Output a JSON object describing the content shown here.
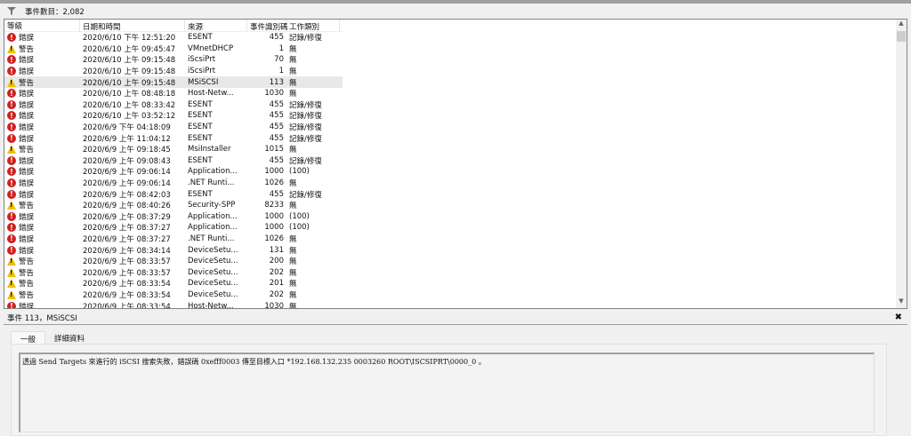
{
  "toolbar": {
    "filter_icon": "filter-icon",
    "count_label": "事件數目：2,082"
  },
  "columns": [
    "等級",
    "日期和時間",
    "來源",
    "事件識別碼",
    "工作類別"
  ],
  "rows": [
    {
      "level": "錯誤",
      "type": "error",
      "date": "2020/6/10 下午 12:51:20",
      "source": "ESENT",
      "id": "455",
      "category": "記錄/修復"
    },
    {
      "level": "警告",
      "type": "warning",
      "date": "2020/6/10 上午 09:45:47",
      "source": "VMnetDHCP",
      "id": "1",
      "category": "無"
    },
    {
      "level": "錯誤",
      "type": "error",
      "date": "2020/6/10 上午 09:15:48",
      "source": "iScsiPrt",
      "id": "70",
      "category": "無"
    },
    {
      "level": "錯誤",
      "type": "error",
      "date": "2020/6/10 上午 09:15:48",
      "source": "iScsiPrt",
      "id": "1",
      "category": "無"
    },
    {
      "level": "警告",
      "type": "warning",
      "date": "2020/6/10 上午 09:15:48",
      "source": "MSiSCSI",
      "id": "113",
      "category": "無",
      "selected": true
    },
    {
      "level": "錯誤",
      "type": "error",
      "date": "2020/6/10 上午 08:48:18",
      "source": "Host-Netw...",
      "id": "1030",
      "category": "無"
    },
    {
      "level": "錯誤",
      "type": "error",
      "date": "2020/6/10 上午 08:33:42",
      "source": "ESENT",
      "id": "455",
      "category": "記錄/修復"
    },
    {
      "level": "錯誤",
      "type": "error",
      "date": "2020/6/10 上午 03:52:12",
      "source": "ESENT",
      "id": "455",
      "category": "記錄/修復"
    },
    {
      "level": "錯誤",
      "type": "error",
      "date": "2020/6/9 下午 04:18:09",
      "source": "ESENT",
      "id": "455",
      "category": "記錄/修復"
    },
    {
      "level": "錯誤",
      "type": "error",
      "date": "2020/6/9 上午 11:04:12",
      "source": "ESENT",
      "id": "455",
      "category": "記錄/修復"
    },
    {
      "level": "警告",
      "type": "warning",
      "date": "2020/6/9 上午 09:18:45",
      "source": "MsiInstaller",
      "id": "1015",
      "category": "無"
    },
    {
      "level": "錯誤",
      "type": "error",
      "date": "2020/6/9 上午 09:08:43",
      "source": "ESENT",
      "id": "455",
      "category": "記錄/修復"
    },
    {
      "level": "錯誤",
      "type": "error",
      "date": "2020/6/9 上午 09:06:14",
      "source": "Application...",
      "id": "1000",
      "category": "(100)"
    },
    {
      "level": "錯誤",
      "type": "error",
      "date": "2020/6/9 上午 09:06:14",
      "source": ".NET Runti...",
      "id": "1026",
      "category": "無"
    },
    {
      "level": "錯誤",
      "type": "error",
      "date": "2020/6/9 上午 08:42:03",
      "source": "ESENT",
      "id": "455",
      "category": "記錄/修復"
    },
    {
      "level": "警告",
      "type": "warning",
      "date": "2020/6/9 上午 08:40:26",
      "source": "Security-SPP",
      "id": "8233",
      "category": "無"
    },
    {
      "level": "錯誤",
      "type": "error",
      "date": "2020/6/9 上午 08:37:29",
      "source": "Application...",
      "id": "1000",
      "category": "(100)"
    },
    {
      "level": "錯誤",
      "type": "error",
      "date": "2020/6/9 上午 08:37:27",
      "source": "Application...",
      "id": "1000",
      "category": "(100)"
    },
    {
      "level": "錯誤",
      "type": "error",
      "date": "2020/6/9 上午 08:37:27",
      "source": ".NET Runti...",
      "id": "1026",
      "category": "無"
    },
    {
      "level": "錯誤",
      "type": "error",
      "date": "2020/6/9 上午 08:34:14",
      "source": "DeviceSetu...",
      "id": "131",
      "category": "無"
    },
    {
      "level": "警告",
      "type": "warning",
      "date": "2020/6/9 上午 08:33:57",
      "source": "DeviceSetu...",
      "id": "200",
      "category": "無"
    },
    {
      "level": "警告",
      "type": "warning",
      "date": "2020/6/9 上午 08:33:57",
      "source": "DeviceSetu...",
      "id": "202",
      "category": "無"
    },
    {
      "level": "警告",
      "type": "warning",
      "date": "2020/6/9 上午 08:33:54",
      "source": "DeviceSetu...",
      "id": "201",
      "category": "無"
    },
    {
      "level": "警告",
      "type": "warning",
      "date": "2020/6/9 上午 08:33:54",
      "source": "DeviceSetu...",
      "id": "202",
      "category": "無"
    },
    {
      "level": "錯誤",
      "type": "error",
      "date": "2020/6/9 上午 08:33:54",
      "source": "Host-Netw...",
      "id": "1030",
      "category": "無"
    }
  ],
  "detail": {
    "title": "事件 113，MSiSCSI",
    "tabs": [
      "一般",
      "詳細資料"
    ],
    "message": "透過 Send Targets 來進行的 iSCSI 搜索失敗，錯誤碼 0xefff0003 傳至目標入口 *192.168.132.235 0003260 ROOT\\ISCSIPRT\\0000_0 。"
  },
  "colors": {
    "error": "#d02020",
    "warning": "#f0c000",
    "selected_row": "#e8e8e8"
  }
}
